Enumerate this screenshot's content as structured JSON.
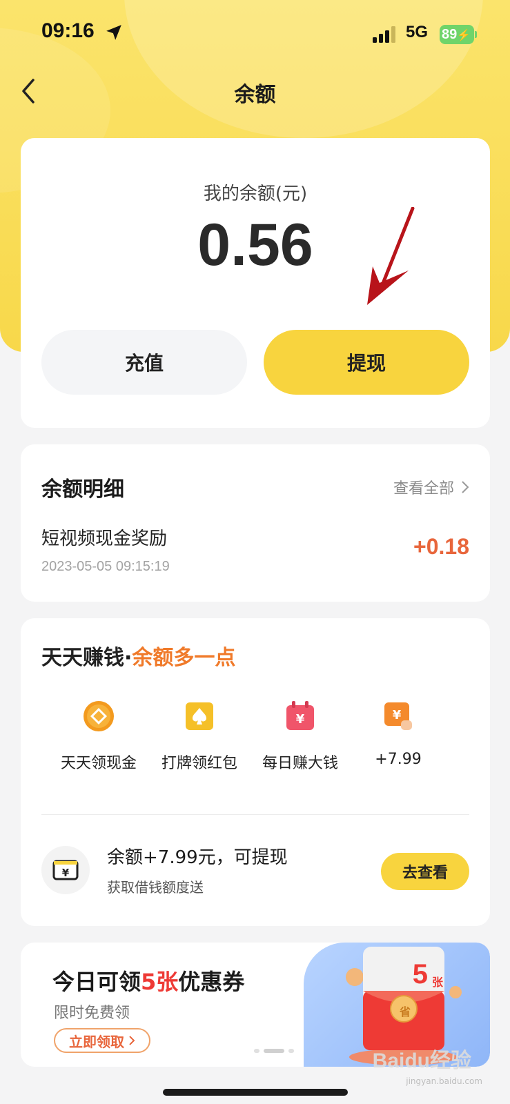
{
  "status_bar": {
    "time": "09:16",
    "network": "5G",
    "battery": "89"
  },
  "nav": {
    "title": "余额"
  },
  "balance": {
    "label": "我的余额(元)",
    "amount": "0.56",
    "recharge_label": "充值",
    "withdraw_label": "提现"
  },
  "details": {
    "title": "余额明细",
    "view_all": "查看全部",
    "transactions": [
      {
        "name": "短视频现金奖励",
        "time": "2023-05-05 09:15:19",
        "amount": "+0.18"
      }
    ]
  },
  "earn": {
    "title_main": "天天赚钱",
    "title_dot": "·",
    "title_highlight": "余额多一点",
    "features": [
      {
        "label": "天天领现金",
        "icon": "coin-icon"
      },
      {
        "label": "打牌领红包",
        "icon": "card-icon"
      },
      {
        "label": "每日赚大钱",
        "icon": "calendar-money-icon"
      },
      {
        "label": "+7.99",
        "icon": "money-hand-icon"
      }
    ],
    "promo": {
      "title": "余额+7.99元，可提现",
      "subtitle": "获取借钱额度送",
      "button": "去查看"
    }
  },
  "banner": {
    "title_pre": "今日可领",
    "title_highlight": "5张",
    "title_post": "优惠券",
    "subtitle": "限时免费领",
    "button": "立即领取",
    "badge_number": "5",
    "badge_unit": "张",
    "badge_save": "省"
  },
  "watermark": {
    "text": "Baidu经验",
    "sub": "jingyan.baidu.com"
  },
  "colors": {
    "accent_yellow": "#f8d43e",
    "orange": "#f07a2a",
    "red": "#ee3a35",
    "amount_positive": "#e8663c"
  }
}
